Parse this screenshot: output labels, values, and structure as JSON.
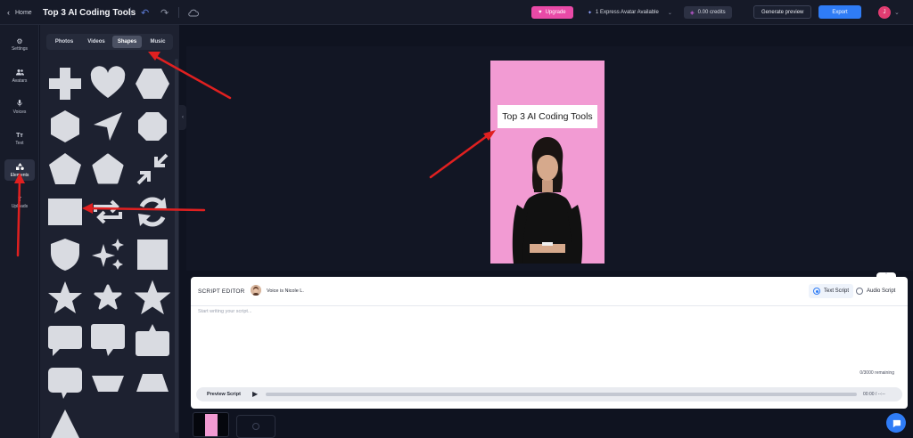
{
  "topbar": {
    "home_label": "Home",
    "project_title": "Top 3 AI Coding Tools",
    "upgrade_label": "Upgrade",
    "express_label": "1 Express Avatar Available",
    "credits_label": "0.00 credits",
    "generate_preview_label": "Generate preview",
    "export_label": "Export",
    "user_initial": "J"
  },
  "nav": {
    "items": [
      {
        "label": "Settings",
        "icon": "gear-icon"
      },
      {
        "label": "Avatars",
        "icon": "people-icon"
      },
      {
        "label": "Voices",
        "icon": "microphone-icon"
      },
      {
        "label": "Text",
        "icon": "text-icon"
      },
      {
        "label": "Elements",
        "icon": "shapes-icon"
      },
      {
        "label": "Uploads",
        "icon": "upload-icon"
      }
    ],
    "active": "Elements"
  },
  "panel": {
    "tabs": [
      "Photos",
      "Videos",
      "Shapes",
      "Music"
    ],
    "active_tab": "Shapes",
    "shapes": [
      "plus",
      "heart",
      "hexagon-horizontal",
      "hexagon",
      "arrow-pointer",
      "octagon",
      "pentagon",
      "pentagon-round",
      "arrows-collapse",
      "rectangle",
      "arrows-swap",
      "refresh",
      "shield",
      "sparkles",
      "square",
      "star",
      "star-round",
      "star-bold",
      "speech-bubble",
      "speech-bubble-tail",
      "speech-bubble-tab",
      "speech-bubble-round",
      "trapezoid-inverted",
      "trapezoid",
      "triangle"
    ]
  },
  "canvas": {
    "title_text": "Top 3 AI Coding Tools",
    "background_color": "#f29bd3"
  },
  "editor": {
    "label": "SCRIPT EDITOR",
    "voice_label": "Voice is Nicole L.",
    "text_script_label": "Text Script",
    "audio_script_label": "Audio Script",
    "placeholder": "Start writing your script...",
    "remaining": "0/3000 remaining",
    "preview_label": "Preview Script",
    "time": "00:00 / --:--"
  },
  "colors": {
    "accent": "#2f7cf6",
    "upgrade": "#e94aa7",
    "annotation": "#e02020"
  }
}
